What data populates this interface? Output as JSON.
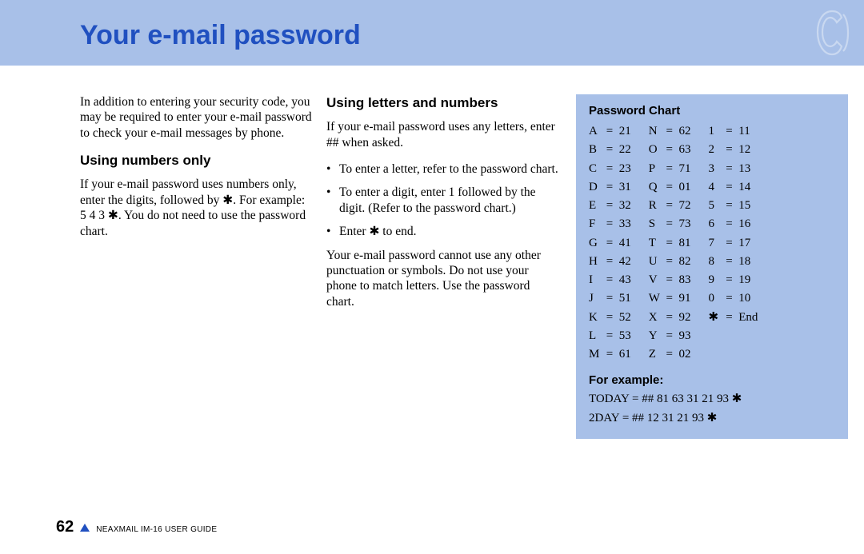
{
  "header": {
    "title": "Your e-mail password"
  },
  "col1": {
    "intro": "In addition to entering your security code, you may be required to enter your e-mail password to check your e-mail messages by phone.",
    "sub1": "Using numbers only",
    "p1": "If your e-mail password uses numbers only, enter the digits, followed by ✱. For example: 5 4 3 ✱. You do not need to use the password chart."
  },
  "col2": {
    "sub1": "Using letters and numbers",
    "p1": "If your e-mail password uses any letters, enter ## when asked.",
    "li1": "To enter a letter, refer to the password chart.",
    "li2": "To enter a digit, enter 1 followed by the digit. (Refer to the password chart.)",
    "li3": "Enter ✱ to end.",
    "p2": "Your e-mail password cannot use any other punctuation or symbols. Do not use your phone to match letters. Use the password chart."
  },
  "chart": {
    "title": "Password Chart",
    "col1": [
      {
        "k": "A",
        "v": "21"
      },
      {
        "k": "B",
        "v": "22"
      },
      {
        "k": "C",
        "v": "23"
      },
      {
        "k": "D",
        "v": "31"
      },
      {
        "k": "E",
        "v": "32"
      },
      {
        "k": "F",
        "v": "33"
      },
      {
        "k": "G",
        "v": "41"
      },
      {
        "k": "H",
        "v": "42"
      },
      {
        "k": "I",
        "v": "43"
      },
      {
        "k": "J",
        "v": "51"
      },
      {
        "k": "K",
        "v": "52"
      },
      {
        "k": "L",
        "v": "53"
      },
      {
        "k": "M",
        "v": "61"
      }
    ],
    "col2": [
      {
        "k": "N",
        "v": "62"
      },
      {
        "k": "O",
        "v": "63"
      },
      {
        "k": "P",
        "v": "71"
      },
      {
        "k": "Q",
        "v": "01"
      },
      {
        "k": "R",
        "v": "72"
      },
      {
        "k": "S",
        "v": "73"
      },
      {
        "k": "T",
        "v": "81"
      },
      {
        "k": "U",
        "v": "82"
      },
      {
        "k": "V",
        "v": "83"
      },
      {
        "k": "W",
        "v": "91"
      },
      {
        "k": "X",
        "v": "92"
      },
      {
        "k": "Y",
        "v": "93"
      },
      {
        "k": "Z",
        "v": "02"
      }
    ],
    "col3": [
      {
        "k": "1",
        "v": "11"
      },
      {
        "k": "2",
        "v": "12"
      },
      {
        "k": "3",
        "v": "13"
      },
      {
        "k": "4",
        "v": "14"
      },
      {
        "k": "5",
        "v": "15"
      },
      {
        "k": "6",
        "v": "16"
      },
      {
        "k": "7",
        "v": "17"
      },
      {
        "k": "8",
        "v": "18"
      },
      {
        "k": "9",
        "v": "19"
      },
      {
        "k": "0",
        "v": "10"
      },
      {
        "k": "✱",
        "v": "End"
      }
    ],
    "forExample": "For example:",
    "ex1": "TODAY = ## 81 63 31 21 93 ✱",
    "ex2": "2DAY = ## 12 31 21 93 ✱"
  },
  "footer": {
    "pageNumber": "62",
    "guide": "NEAXMAIL IM-16 USER GUIDE"
  }
}
